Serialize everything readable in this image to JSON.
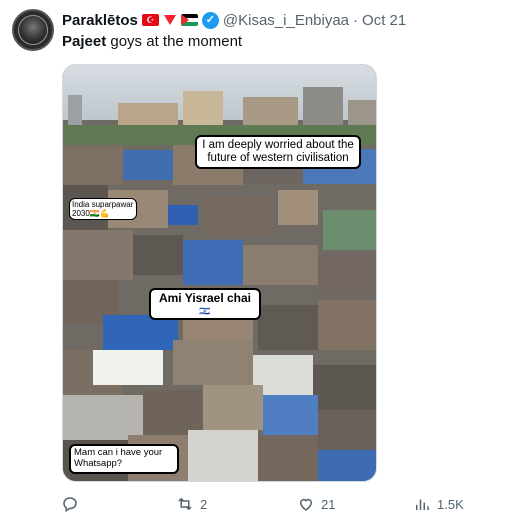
{
  "author": {
    "name": "Paraklētos",
    "handle": "@Kisas_i_Enbiyaa",
    "separator": "·",
    "date": "Oct 21",
    "flag_tr_glyph": "☪",
    "verified_glyph": "✓"
  },
  "tweet": {
    "bold_word": "Pajeet",
    "rest": " goys at the moment"
  },
  "image": {
    "bubble_top": "I am deeply worried about the future of western civilisation",
    "bubble_left": "India suparpawar 2030🇮🇳💪",
    "bubble_mid": "Ami Yisrael chai",
    "bubble_mid_flag": "🇮🇱",
    "bubble_bottom": "Mam can i have your Whatsapp?"
  },
  "actions": {
    "replies": "",
    "retweets": "2",
    "likes": "21",
    "views": "1.5K"
  },
  "colors": {
    "accent": "#1d9bf0",
    "muted": "#536471"
  }
}
